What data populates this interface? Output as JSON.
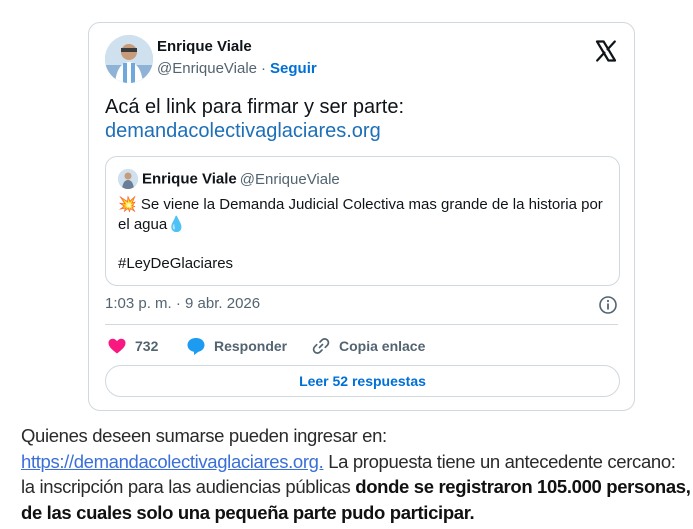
{
  "tweet": {
    "author_name": "Enrique Viale",
    "author_handle": "@EnriqueViale",
    "separator": "·",
    "follow_label": "Seguir",
    "text": "Acá el link para firmar y ser parte:",
    "link": "demandacolectivaglaciares.org",
    "quoted": {
      "author_name": "Enrique Viale",
      "author_handle": "@EnriqueViale",
      "emoji_start": "💥",
      "body": "Se viene la Demanda Judicial Colectiva mas grande de la historia por el agua",
      "emoji_end": "💧",
      "hashtag": "#LeyDeGlaciares"
    },
    "time": "1:03 p. m.",
    "date": "9 abr. 2026",
    "likes": "732",
    "reply_label": "Responder",
    "copy_label": "Copia enlace",
    "read_replies_label": "Leer 52 respuestas"
  },
  "article": {
    "line1": "Quienes deseen sumarse pueden ingresar en:",
    "link": "https://demandacolectivaglaciares.org.",
    "after_link": " La propuesta tiene un antecedente cercano: la inscripción para las audiencias públicas ",
    "bold": "donde se registraron 105.000 personas, de las cuales solo una pequeña parte pudo participar."
  },
  "colors": {
    "link_blue": "#1d6fb8",
    "follow_blue": "#006fd6",
    "heart_pink": "#f91880",
    "reply_blue": "#1d9bf0",
    "article_link": "#3a6fd8"
  },
  "icons": [
    "x-logo-icon",
    "info-icon",
    "heart-icon",
    "reply-bubble-icon",
    "link-icon"
  ]
}
